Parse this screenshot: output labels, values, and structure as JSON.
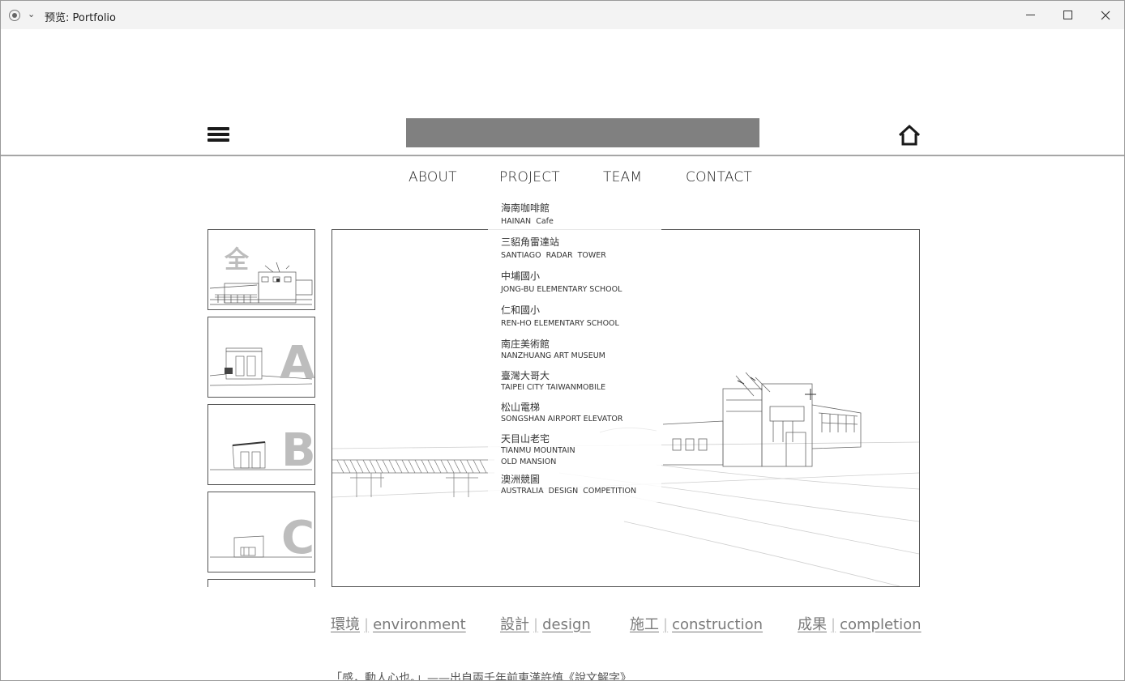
{
  "window": {
    "title": "预览: Portfolio",
    "controls": {
      "minimize": "minimize-icon",
      "maximize": "maximize-icon",
      "close": "close-icon"
    }
  },
  "header": {
    "menu_icon": "hamburger-icon",
    "home_icon": "home-icon",
    "logo_color": "#808080"
  },
  "nav": {
    "items": [
      {
        "label": "ABOUT"
      },
      {
        "label": "PROJECT"
      },
      {
        "label": "TEAM"
      },
      {
        "label": "CONTACT"
      }
    ]
  },
  "project_menu": {
    "items": [
      {
        "zh": "海南咖啡館",
        "en": "HAINAN  Cafe"
      },
      {
        "zh": "三貂角雷達站",
        "en": "SANTIAGO  RADAR  TOWER"
      },
      {
        "zh": "中埔國小",
        "en": "JONG-BU ELEMENTARY SCHOOL"
      },
      {
        "zh": "仁和國小",
        "en": "REN-HO ELEMENTARY SCHOOL"
      },
      {
        "zh": "南庄美術館",
        "en": "NANZHUANG ART MUSEUM"
      },
      {
        "zh": "臺灣大哥大",
        "en": "TAIPEI CITY TAIWANMOBILE"
      },
      {
        "zh": "松山電梯",
        "en": "SONGSHAN AIRPORT ELEVATOR"
      },
      {
        "zh": "天目山老宅",
        "en": "TIANMU MOUNTAIN",
        "en2": "OLD MANSION"
      },
      {
        "zh": "澳洲競圖",
        "en": "AUSTRALIA  DESIGN  COMPETITION"
      }
    ]
  },
  "thumbnails": [
    {
      "label": "全"
    },
    {
      "label": "A"
    },
    {
      "label": "B"
    },
    {
      "label": "C"
    }
  ],
  "categories": [
    {
      "zh": "環境",
      "en": "environment"
    },
    {
      "zh": "設計",
      "en": "design"
    },
    {
      "zh": "施工",
      "en": "construction"
    },
    {
      "zh": "成果",
      "en": "completion"
    }
  ],
  "separator": "|",
  "quote": "「感，動人心也。」——出自兩千年前東漢許慎《說文解字》"
}
